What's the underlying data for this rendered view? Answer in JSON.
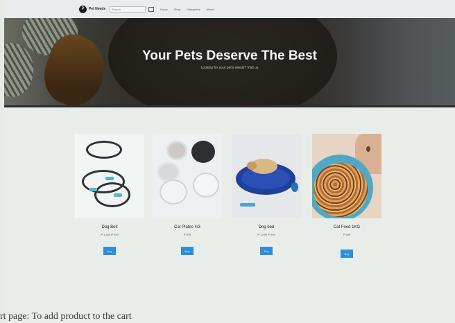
{
  "navbar": {
    "logo_mark": "P",
    "brand": "Pet Needs",
    "search_placeholder": "Search",
    "links": [
      "Home",
      "Shop",
      "Categories",
      "About"
    ]
  },
  "hero": {
    "title": "Your Pets Deserve The Best",
    "subtitle": "Looking for your pet's needs? Visit us"
  },
  "products": [
    {
      "name": "Dog Belt",
      "price": "₱ 1,599 ₱ 999",
      "button": "Buy"
    },
    {
      "name": "Cat Plates 4/3",
      "price": "₱ 999",
      "button": "Buy"
    },
    {
      "name": "Dog bed",
      "price": "₱ 1,599 ₱ 999",
      "button": "Buy"
    },
    {
      "name": "Cat Food 1KG",
      "price": "₱ 599",
      "button": "Buy"
    }
  ],
  "caption": "rt page: To add product to the cart",
  "colors": {
    "button": "#2e8fd8",
    "page_bg": "#e9edea",
    "hero_text": "#f6f6f6"
  }
}
